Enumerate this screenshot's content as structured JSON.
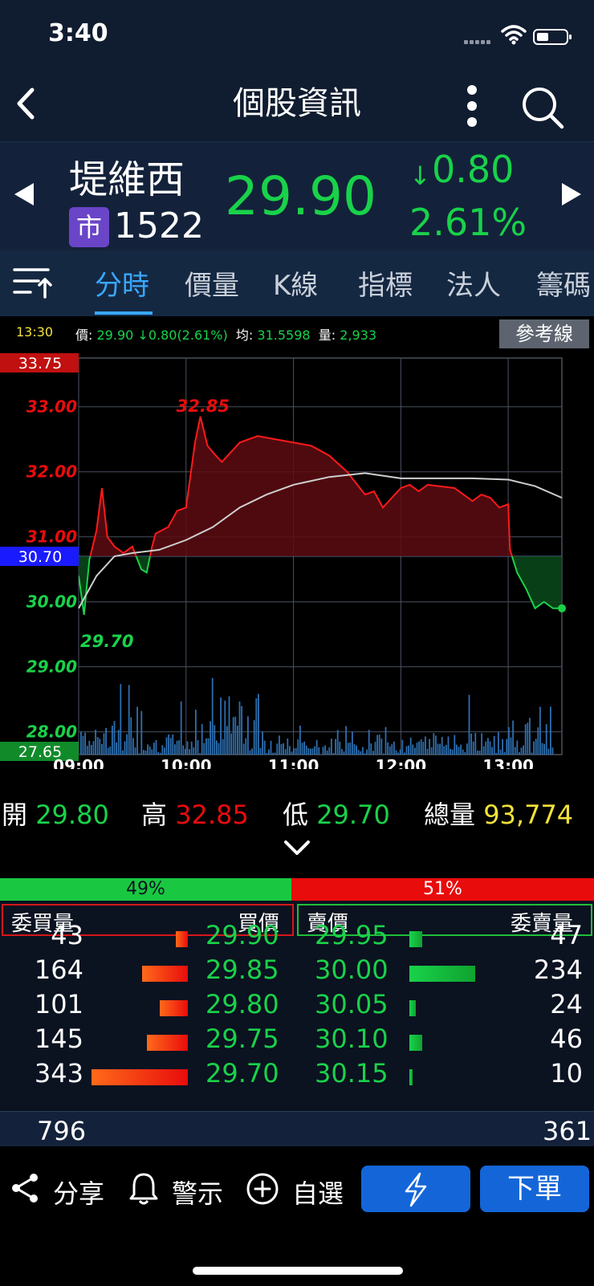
{
  "status_bar": {
    "time": "3:40"
  },
  "header": {
    "title": "個股資訊"
  },
  "stock": {
    "name": "堤維西",
    "market_badge": "市",
    "code": "1522",
    "price": "29.90",
    "change_arrow": "↓",
    "change": "0.80",
    "change_pct": "2.61%",
    "color_down": "#19d24a",
    "color_up": "#e80c0c"
  },
  "tabs": [
    {
      "label": "分時"
    },
    {
      "label": "價量"
    },
    {
      "label": "K線"
    },
    {
      "label": "指標"
    },
    {
      "label": "法人"
    },
    {
      "label": "籌碼"
    }
  ],
  "info_line": {
    "time": "13:30",
    "price_label": "價:",
    "price": "29.90",
    "change": "↓0.80(2.61%)",
    "avg_label": "均:",
    "avg": "31.5598",
    "vol_label": "量:",
    "vol": "2,933",
    "ref_button": "參考線"
  },
  "chart_data": {
    "type": "line",
    "ylim": [
      27.65,
      33.75
    ],
    "reference": 30.7,
    "y_ticks": [
      "33.00",
      "32.00",
      "31.00",
      "30.00",
      "29.00",
      "28.00"
    ],
    "y_tick_values": [
      33.0,
      32.0,
      31.0,
      30.0,
      29.0,
      28.0
    ],
    "top_label": "33.75",
    "bottom_label": "27.65",
    "ref_label": "30.70",
    "x_ticks": [
      "09:00",
      "10:00",
      "11:00",
      "12:00",
      "13:00"
    ],
    "high_annotation": "32.85",
    "low_annotation": "29.70",
    "price_series": {
      "x": [
        "09:00",
        "09:03",
        "09:06",
        "09:10",
        "09:13",
        "09:16",
        "09:20",
        "09:25",
        "09:30",
        "09:35",
        "09:38",
        "09:41",
        "09:43",
        "09:50",
        "09:55",
        "10:00",
        "10:05",
        "10:08",
        "10:12",
        "10:15",
        "10:20",
        "10:30",
        "10:40",
        "10:50",
        "11:00",
        "11:10",
        "11:20",
        "11:30",
        "11:40",
        "11:45",
        "11:50",
        "12:00",
        "12:05",
        "12:10",
        "12:15",
        "12:30",
        "12:40",
        "12:45",
        "12:50",
        "12:55",
        "13:00",
        "13:01",
        "13:05",
        "13:10",
        "13:15",
        "13:20",
        "13:25",
        "13:30"
      ],
      "y": [
        30.4,
        29.8,
        30.65,
        31.1,
        31.75,
        31.0,
        30.85,
        30.75,
        30.85,
        30.5,
        30.45,
        30.85,
        31.05,
        31.15,
        31.4,
        31.45,
        32.45,
        32.85,
        32.4,
        32.3,
        32.15,
        32.45,
        32.55,
        32.5,
        32.45,
        32.4,
        32.25,
        32.0,
        31.65,
        31.7,
        31.45,
        31.75,
        31.8,
        31.7,
        31.8,
        31.75,
        31.55,
        31.65,
        31.6,
        31.45,
        31.5,
        30.8,
        30.45,
        30.2,
        29.9,
        30.0,
        29.9,
        29.9
      ]
    },
    "avg_series": {
      "x": [
        "09:00",
        "09:10",
        "09:20",
        "09:30",
        "09:45",
        "10:00",
        "10:15",
        "10:30",
        "10:45",
        "11:00",
        "11:20",
        "11:40",
        "12:00",
        "12:20",
        "12:40",
        "13:00",
        "13:15",
        "13:30"
      ],
      "y": [
        29.9,
        30.4,
        30.7,
        30.75,
        30.8,
        30.95,
        31.15,
        31.45,
        31.65,
        31.8,
        31.92,
        31.98,
        31.9,
        31.9,
        31.9,
        31.88,
        31.78,
        31.6
      ]
    }
  },
  "ohlc": {
    "open_label": "開",
    "open": "29.80",
    "high_label": "高",
    "high": "32.85",
    "low_label": "低",
    "low": "29.70",
    "vol_label": "總量",
    "vol": "93,774"
  },
  "ratio": {
    "buy": "49%",
    "buy_value": 49,
    "sell": "51%",
    "sell_value": 51
  },
  "order_book": {
    "headers": {
      "bid_qty": "委買量",
      "bid_price": "買價",
      "ask_price": "賣價",
      "ask_qty": "委賣量"
    },
    "rows": [
      {
        "bid_qty": "43",
        "bid_price": "29.90",
        "ask_price": "29.95",
        "ask_qty": "47",
        "bid_q": 43,
        "ask_q": 47
      },
      {
        "bid_qty": "164",
        "bid_price": "29.85",
        "ask_price": "30.00",
        "ask_qty": "234",
        "bid_q": 164,
        "ask_q": 234
      },
      {
        "bid_qty": "101",
        "bid_price": "29.80",
        "ask_price": "30.05",
        "ask_qty": "24",
        "bid_q": 101,
        "ask_q": 24
      },
      {
        "bid_qty": "145",
        "bid_price": "29.75",
        "ask_price": "30.10",
        "ask_qty": "46",
        "bid_q": 145,
        "ask_q": 46
      },
      {
        "bid_qty": "343",
        "bid_price": "29.70",
        "ask_price": "30.15",
        "ask_qty": "10",
        "bid_q": 343,
        "ask_q": 10
      }
    ],
    "total_bid": "796",
    "total_ask": "361"
  },
  "bottom_bar": {
    "share": "分享",
    "alert": "警示",
    "watchlist": "自選",
    "order": "下單",
    "icons": [
      "share-icon",
      "bell-icon",
      "plus-circle-icon",
      "lightning-icon"
    ]
  }
}
